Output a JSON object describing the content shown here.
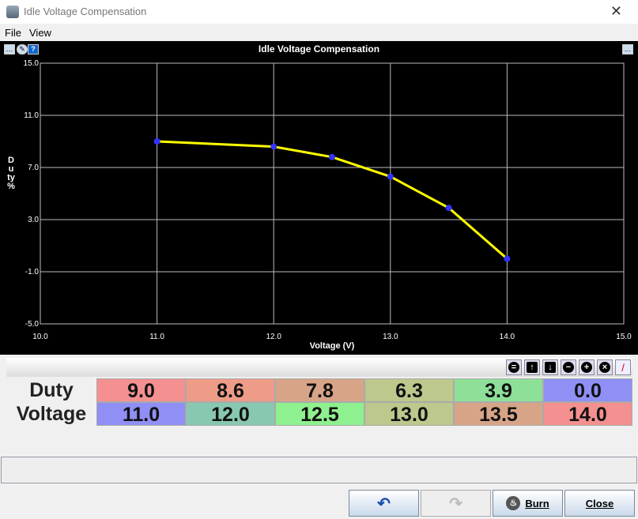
{
  "window": {
    "title": "Idle Voltage Compensation",
    "close": "✕"
  },
  "menu": [
    "File",
    "View"
  ],
  "chart_data": {
    "type": "line",
    "title": "Idle Voltage Compensation",
    "xlabel": "Voltage (V)",
    "ylabel": "Duty %",
    "xlim": [
      10,
      15
    ],
    "ylim": [
      -5,
      15
    ],
    "xticks": [
      "10.0",
      "11.0",
      "12.0",
      "13.0",
      "14.0",
      "15.0"
    ],
    "yticks": [
      "15.0",
      "11.0",
      "7.0",
      "3.0",
      "-1.0",
      "-5.0"
    ],
    "x": [
      11.0,
      12.0,
      12.5,
      13.0,
      13.5,
      14.0
    ],
    "y": [
      9.0,
      8.6,
      7.8,
      6.3,
      3.9,
      0.0
    ],
    "line_color": "#ffff00",
    "point_color": "#3333ff",
    "grid": true
  },
  "table": {
    "rows": [
      {
        "label": "Duty",
        "values": [
          "9.0",
          "8.6",
          "7.8",
          "6.3",
          "3.9",
          "0.0"
        ],
        "colors": [
          "#f59090",
          "#ee9c88",
          "#d8a488",
          "#bcc88c",
          "#8ee099",
          "#8f8ff5"
        ]
      },
      {
        "label": "Voltage",
        "values": [
          "11.0",
          "12.0",
          "12.5",
          "13.0",
          "13.5",
          "14.0"
        ],
        "colors": [
          "#8f8ff5",
          "#88c8b0",
          "#8ef08e",
          "#bcc88c",
          "#d8a488",
          "#f59090"
        ]
      }
    ]
  },
  "buttons": {
    "burn": "Burn",
    "close": "Close"
  }
}
